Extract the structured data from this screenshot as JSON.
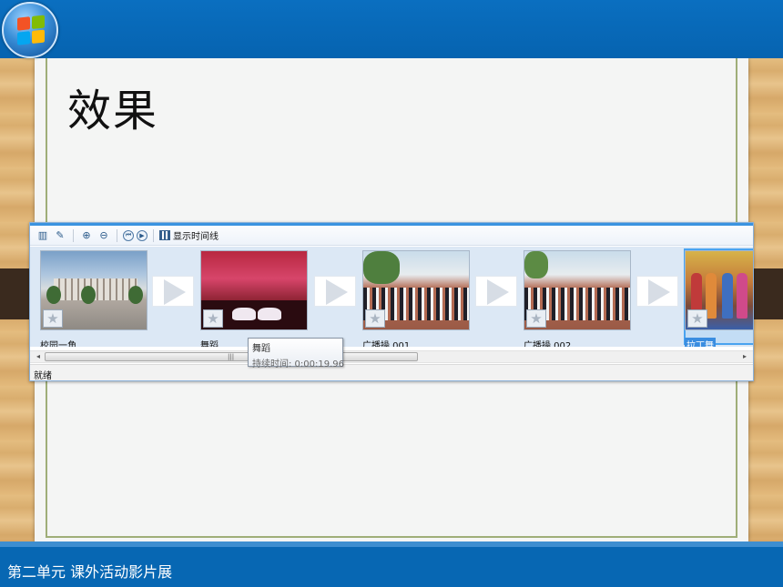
{
  "slide": {
    "title": "效果",
    "footer": "第二单元  课外活动影片展"
  },
  "colors": {
    "top_bar": "#0663b0",
    "bottom_bar": "#0767b3",
    "paper": "#f4f5f4",
    "selection": "#3a8de0"
  },
  "app": {
    "toolbar": {
      "icons": [
        "storyboard-icon",
        "pin-icon",
        "zoom-in-icon",
        "zoom-out-icon",
        "rewind-icon",
        "play-icon"
      ],
      "timeline_label": "显示时间线"
    },
    "clips": [
      {
        "label": "校园一角",
        "selected": false
      },
      {
        "label": "舞蹈",
        "selected": false
      },
      {
        "label": "广播操 001",
        "selected": false
      },
      {
        "label": "广播操 002",
        "selected": false
      },
      {
        "label": "拉丁舞",
        "selected": true
      }
    ],
    "scrollbar": {
      "grip": "|||",
      "left": "◂",
      "right": "▸"
    },
    "status": "就绪",
    "tooltip": {
      "name": "舞蹈",
      "duration": "持续时间:  0:00:19.96"
    }
  }
}
